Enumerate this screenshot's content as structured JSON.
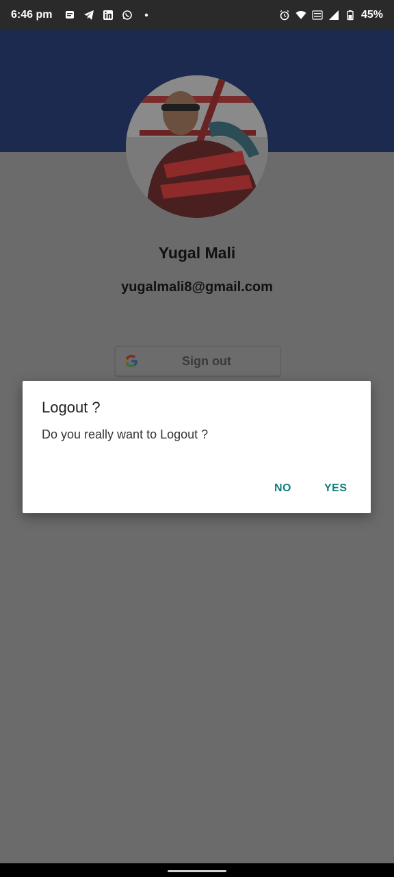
{
  "status_bar": {
    "time": "6:46 pm",
    "battery": "45%",
    "left_icons": [
      "message-icon",
      "telegram-icon",
      "linkedin-icon",
      "whatsapp-icon",
      "dot-icon"
    ],
    "right_icons": [
      "alarm-icon",
      "wifi-icon",
      "volte-wifi-icon",
      "signal-icon",
      "battery-icon"
    ]
  },
  "profile": {
    "name": "Yugal Mali",
    "email": "yugalmali8@gmail.com"
  },
  "sign_out_button": {
    "label": "Sign out",
    "icon": "google-icon"
  },
  "dialog": {
    "title": "Logout ?",
    "message": "Do you really want to Logout ?",
    "no_label": "NO",
    "yes_label": "YES"
  },
  "colors": {
    "header": "#1b2a4e",
    "dim_background": "#6b6b6b",
    "accent": "#0f7f7a"
  }
}
